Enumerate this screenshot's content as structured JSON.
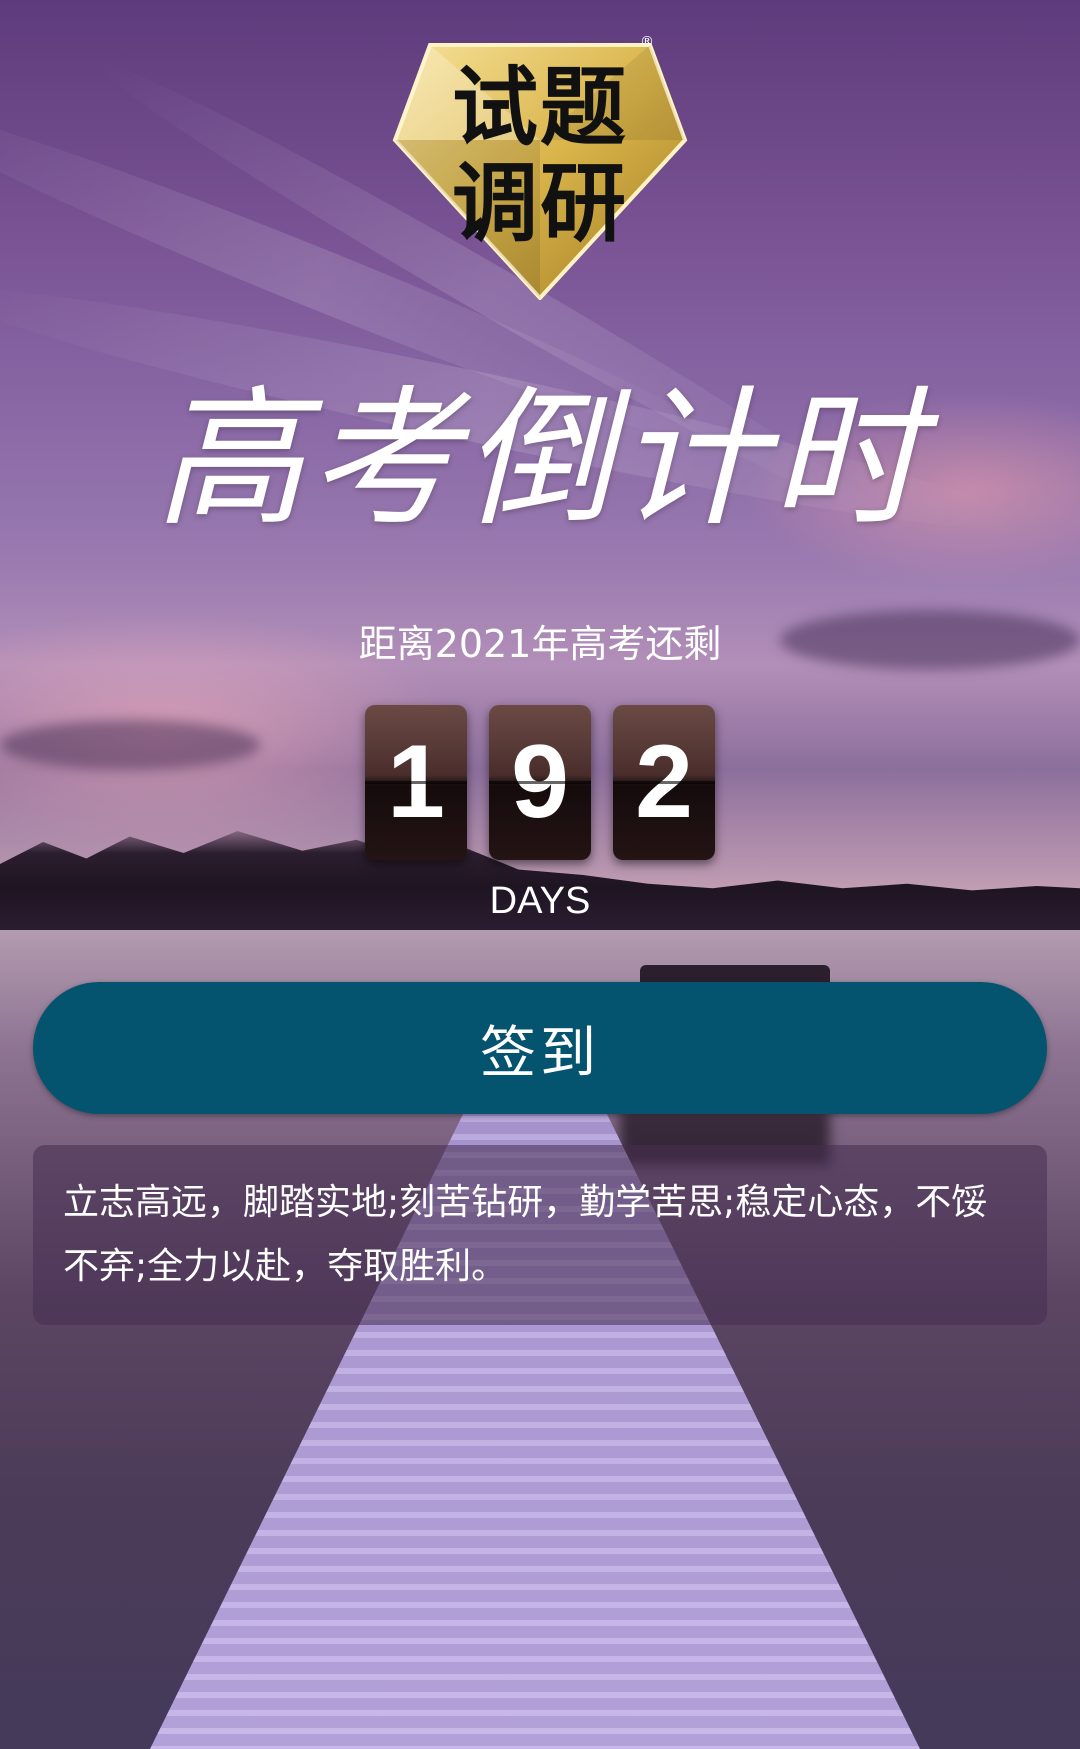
{
  "logo": {
    "line1": "试题",
    "line2": "调研",
    "registered": "®"
  },
  "title": "高考倒计时",
  "countdown": {
    "caption": "距离2021年高考还剩",
    "days_digits": [
      "1",
      "9",
      "2"
    ],
    "unit": "DAYS"
  },
  "signin": {
    "label": "签到"
  },
  "motto": {
    "text": "立志高远，脚踏实地;刻苦钻研，勤学苦思;稳定心态，不馁不弃;全力以赴，夺取胜利。"
  },
  "colors": {
    "button": "#05546f",
    "logo_gold": "#d9b44a"
  }
}
